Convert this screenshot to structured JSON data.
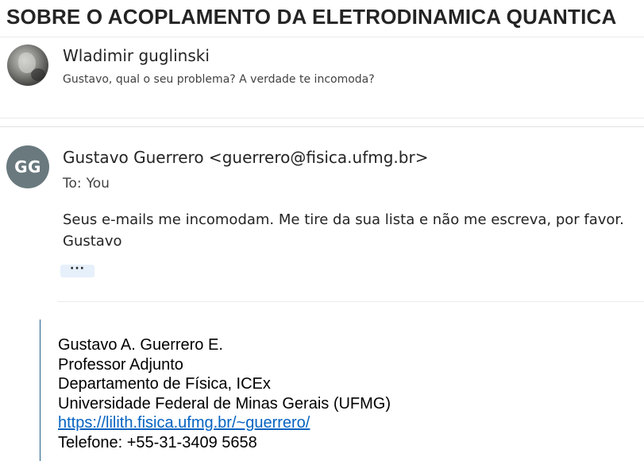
{
  "subject": "SOBRE O ACOPLAMENTO DA ELETRODINAMICA QUANTICA",
  "messages": [
    {
      "sender": "Wladimir guglinski",
      "preview": "Gustavo, qual o seu problema? A verdade te incomoda?"
    },
    {
      "initials": "GG",
      "avatar_color": "#69797e",
      "from": "Gustavo Guerrero <guerrero@fisica.ufmg.br>",
      "to_label": "To:",
      "to_value": "You",
      "body_lines": [
        "Seus e-mails me incomodam.  Me tire da sua lista e não me escreva, por favor.",
        "Gustavo"
      ],
      "more_label": "···",
      "signature": {
        "name": "Gustavo A. Guerrero E.",
        "title": "Professor Adjunto",
        "department": "Departamento de Física, ICEx",
        "university": "Universidade Federal de Minas Gerais (UFMG)",
        "link": "https://lilith.fisica.ufmg.br/~guerrero/",
        "phone": "Telefone: +55-31-3409 5658"
      }
    }
  ],
  "colors": {
    "link": "#0563c1",
    "quote_bar": "#1f5f8b",
    "more_button_bg": "#e6f0fb"
  }
}
